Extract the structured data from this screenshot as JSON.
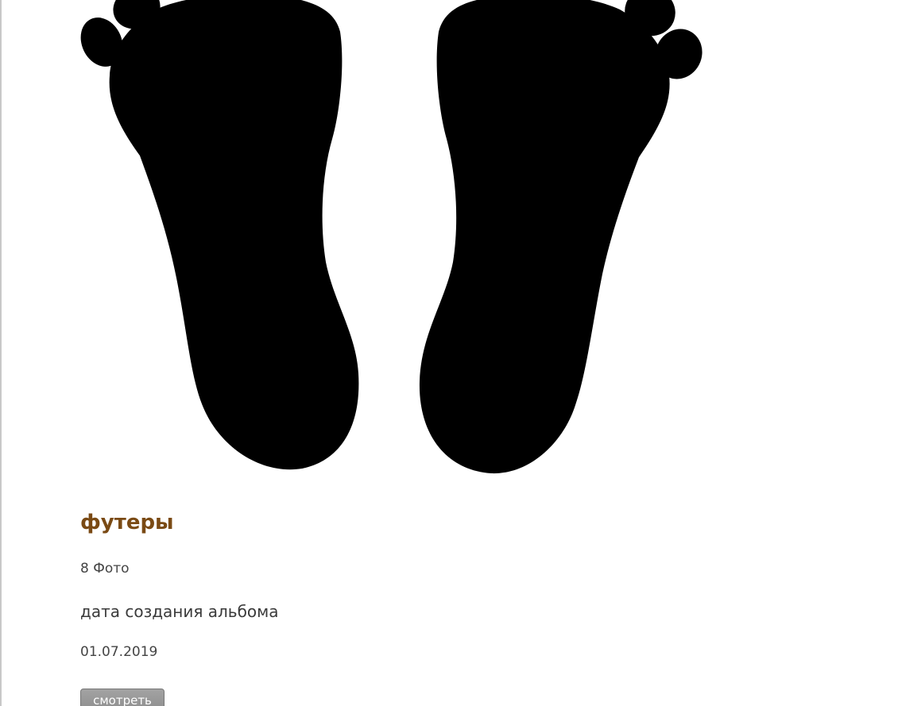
{
  "album": {
    "cover_icon": "footprints-icon",
    "title": "футеры",
    "title_color": "#7a4a14",
    "photo_count": "8 Фото",
    "date_label": "дата создания альбома",
    "date_value": "01.07.2019",
    "view_button_label": "смотреть"
  }
}
